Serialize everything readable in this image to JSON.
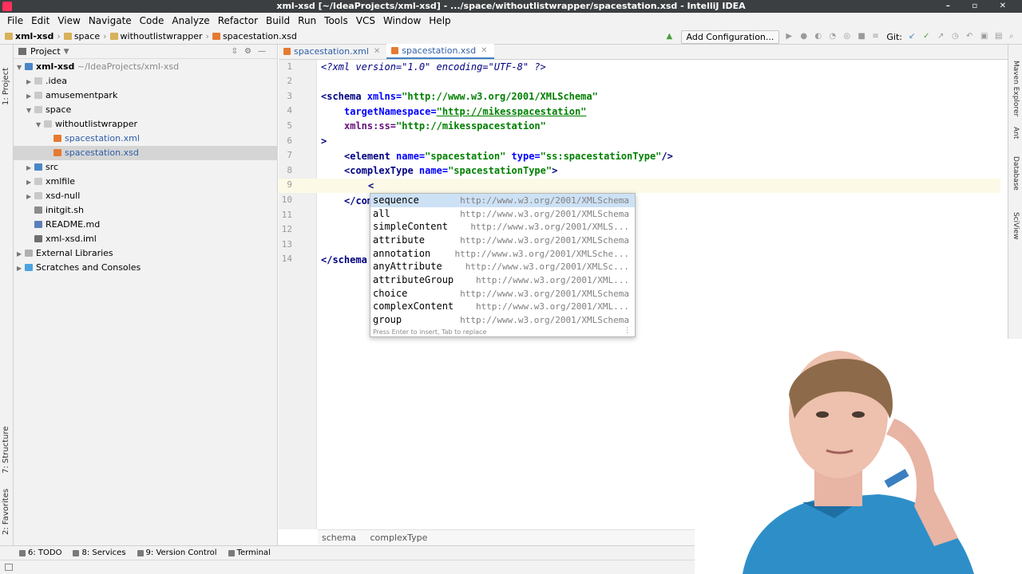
{
  "window": {
    "title": "xml-xsd [~/IdeaProjects/xml-xsd] - .../space/withoutlistwrapper/spacestation.xsd - IntelliJ IDEA"
  },
  "menu": [
    "File",
    "Edit",
    "View",
    "Navigate",
    "Code",
    "Analyze",
    "Refactor",
    "Build",
    "Run",
    "Tools",
    "VCS",
    "Window",
    "Help"
  ],
  "navbar": {
    "crumbs": [
      "xml-xsd",
      "space",
      "withoutlistwrapper",
      "spacestation.xsd"
    ],
    "add_configuration": "Add Configuration...",
    "git_label": "Git:"
  },
  "left_strip": {
    "project": "1: Project",
    "structure": "7: Structure",
    "favorites": "2: Favorites"
  },
  "project_panel": {
    "title": "Project",
    "root_name": "xml-xsd",
    "root_path": "~/IdeaProjects/xml-xsd",
    "items": [
      {
        "label": "xml-xsd",
        "path": "~/IdeaProjects/xml-xsd"
      },
      {
        "label": ".idea"
      },
      {
        "label": "amusementpark"
      },
      {
        "label": "space"
      },
      {
        "label": "withoutlistwrapper"
      },
      {
        "label": "spacestation.xml"
      },
      {
        "label": "spacestation.xsd"
      },
      {
        "label": "src"
      },
      {
        "label": "xmlfile"
      },
      {
        "label": "xsd-null"
      },
      {
        "label": "initgit.sh"
      },
      {
        "label": "README.md"
      },
      {
        "label": "xml-xsd.iml"
      },
      {
        "label": "External Libraries"
      },
      {
        "label": "Scratches and Consoles"
      }
    ]
  },
  "editor_tabs": [
    {
      "label": "spacestation.xml",
      "active": false
    },
    {
      "label": "spacestation.xsd",
      "active": true
    }
  ],
  "code": {
    "line_numbers": [
      "1",
      "2",
      "3",
      "4",
      "5",
      "6",
      "7",
      "8",
      "9",
      "10",
      "11",
      "12",
      "13",
      "14"
    ],
    "l1_pi": "<?xml version=\"1.0\" encoding=\"UTF-8\" ?>",
    "l3_open": "<schema",
    "l3_attr": " xmlns=",
    "l3_val": "\"http://www.w3.org/2001/XMLSchema\"",
    "l4_attr": "targetNamespace=",
    "l4_val": "\"http://mikesspacestation\"",
    "l5_attr": "xmlns:ss=",
    "l5_val": "\"http://mikesspacestation\"",
    "l6": ">",
    "l7_open": "<element",
    "l7_attr1": " name=",
    "l7_val1": "\"spacestation\"",
    "l7_attr2": " type=",
    "l7_val2": "\"ss:spacestationType\"",
    "l7_close": "/>",
    "l8_open": "<complexType",
    "l8_attr": " name=",
    "l8_val": "\"spacestationType\"",
    "l8_close": ">",
    "l9": "<",
    "l10": "</com",
    "l14": "</schema"
  },
  "completion": {
    "items": [
      {
        "name": "sequence",
        "url": "http://www.w3.org/2001/XMLSchema"
      },
      {
        "name": "all",
        "url": "http://www.w3.org/2001/XMLSchema"
      },
      {
        "name": "simpleContent",
        "url": "http://www.w3.org/2001/XMLS..."
      },
      {
        "name": "attribute",
        "url": "http://www.w3.org/2001/XMLSchema"
      },
      {
        "name": "annotation",
        "url": "http://www.w3.org/2001/XMLSche..."
      },
      {
        "name": "anyAttribute",
        "url": "http://www.w3.org/2001/XMLSc..."
      },
      {
        "name": "attributeGroup",
        "url": "http://www.w3.org/2001/XML..."
      },
      {
        "name": "choice",
        "url": "http://www.w3.org/2001/XMLSchema"
      },
      {
        "name": "complexContent",
        "url": "http://www.w3.org/2001/XML..."
      },
      {
        "name": "group",
        "url": "http://www.w3.org/2001/XMLSchema"
      }
    ],
    "hint": "Press Enter to insert, Tab to replace"
  },
  "right_strip": [
    "Maven Explorer",
    "Ant",
    "Database",
    "SciView"
  ],
  "editor_breadcrumb": [
    "schema",
    "complexType"
  ],
  "bottom_tools": [
    "6: TODO",
    "8: Services",
    "9: Version Control",
    "Terminal"
  ]
}
